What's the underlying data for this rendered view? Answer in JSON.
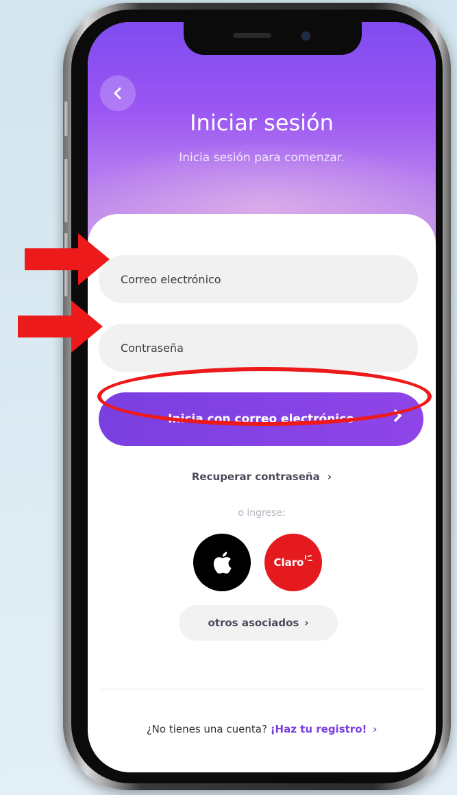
{
  "login": {
    "title": "Iniciar sesión",
    "subtitle": "Inicia sesión para comenzar.",
    "email_placeholder": "Correo electrónico",
    "password_placeholder": "Contraseña",
    "email_button_label": "Inicia con correo electrónico",
    "recover_label": "Recuperar contraseña",
    "or_label": "o ingrese:",
    "claro_label": "Claro",
    "others_label": "otros asociados",
    "no_account_text": "¿No tienes una cuenta?",
    "register_link": "¡Haz tu registro!"
  },
  "icons": {
    "back": "chevron-left-icon",
    "apple": "apple-icon",
    "chevron": "chevron-right-icon"
  },
  "colors": {
    "primary": "#8f45e8",
    "hero_top": "#7f4cf0",
    "claro_red": "#e51a1e",
    "annotation_red": "#ec1a1a"
  }
}
